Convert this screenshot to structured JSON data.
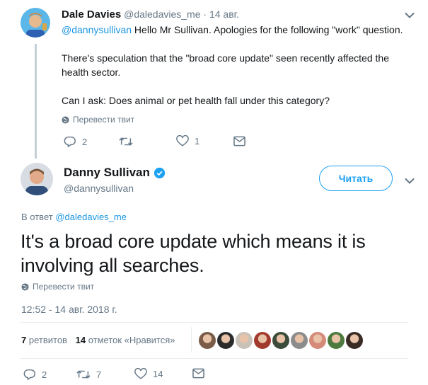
{
  "reply_tweet": {
    "author_name": "Dale Davies",
    "author_handle": "@daledavies_me",
    "separator": "·",
    "date": "14 авг.",
    "mention": "@dannysullivan",
    "line1_rest": " Hello Mr Sullivan. Apologies for the following \"work\" question.",
    "line2": "There's speculation that the \"broad core update\" seen recently affected the health sector.",
    "line3": "Can I ask: Does animal or pet health fall under this category?",
    "translate_label": "Перевести твит",
    "replies": "2",
    "retweets": "",
    "likes": "1"
  },
  "main_tweet": {
    "author_name": "Danny Sullivan",
    "author_handle": "@dannysullivan",
    "follow_label": "Читать",
    "reply_to_prefix": "В ответ",
    "reply_to_handle": "@daledavies_me",
    "text": "It's a broad core update which means it is involving all searches.",
    "translate_label": "Перевести твит",
    "timestamp": "12:52 - 14 авг. 2018 г.",
    "retweet_count": "7",
    "retweet_label": "ретвитов",
    "like_count": "14",
    "like_label": "отметок «Нравится»",
    "actions": {
      "replies": "2",
      "retweets": "7",
      "likes": "14"
    }
  },
  "colors": {
    "accent": "#1da1f2",
    "link": "#1b95e0",
    "muted": "#657786",
    "verified": "#1da1f2"
  },
  "liker_avatars": [
    "#7a5c48",
    "#2b2b2b",
    "#c9c2b8",
    "#a33a2e",
    "#3b4d3a",
    "#8c8c8c",
    "#d68a7a",
    "#4d7a3e",
    "#3a2b24"
  ]
}
